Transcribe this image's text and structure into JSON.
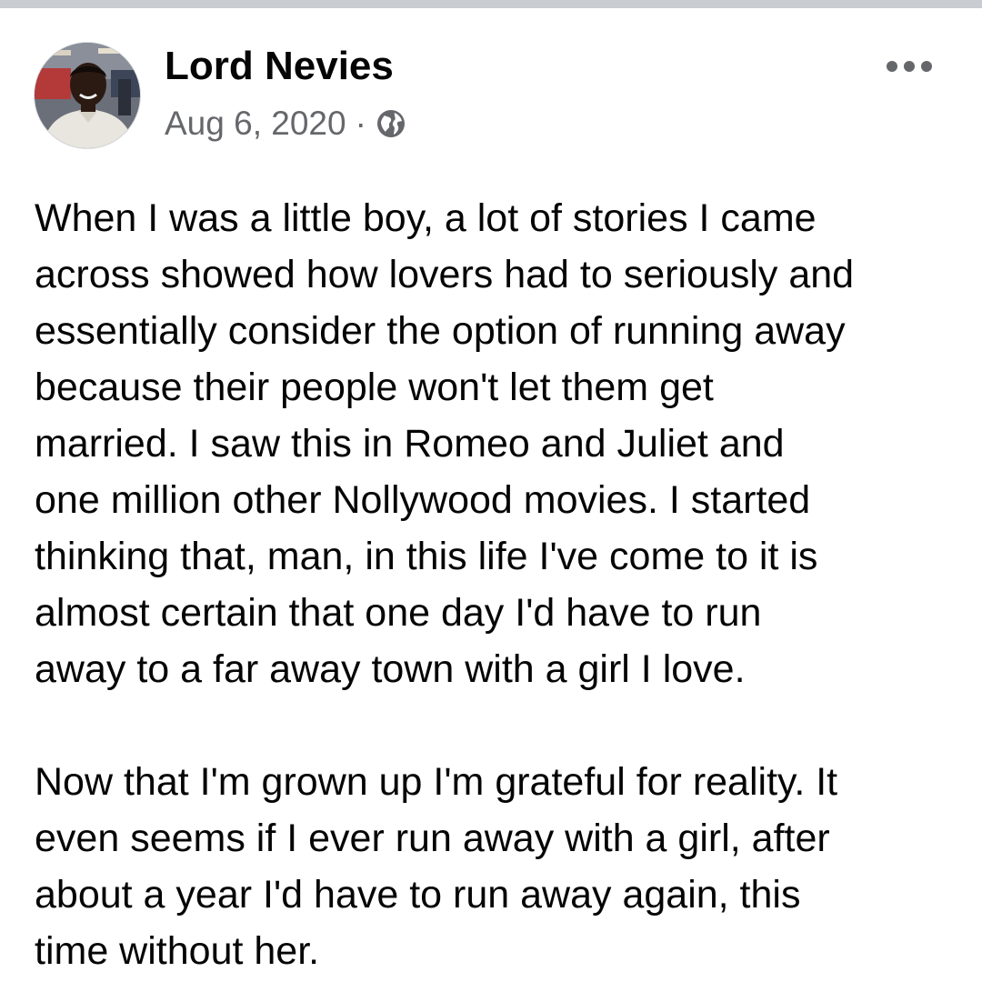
{
  "post": {
    "author_name": "Lord Nevies",
    "date": "Aug 6, 2020",
    "separator": "·",
    "audience_icon": "globe-icon",
    "menu_icon": "more-options-icon",
    "paragraphs": [
      {
        "lines": [
          "When I was a little boy, a lot of stories I came",
          "across showed how lovers had to seriously and",
          "essentially consider the option of running away",
          "because their people won't let them get",
          "married. I saw this in Romeo and Juliet and",
          "one million other Nollywood movies. I started",
          "thinking that, man, in this life I've come to it is",
          "almost certain that one day I'd have to run",
          "away to a far away town with a girl I love."
        ]
      },
      {
        "lines": [
          "Now that I'm grown up I'm grateful for reality. It",
          "even seems if I ever run away with a girl, after",
          "about a year I'd have to run away again, this",
          "time without her."
        ]
      }
    ]
  },
  "colors": {
    "text_primary": "#050505",
    "text_secondary": "#65676b",
    "top_strip": "#c9ccd1",
    "background": "#ffffff"
  }
}
